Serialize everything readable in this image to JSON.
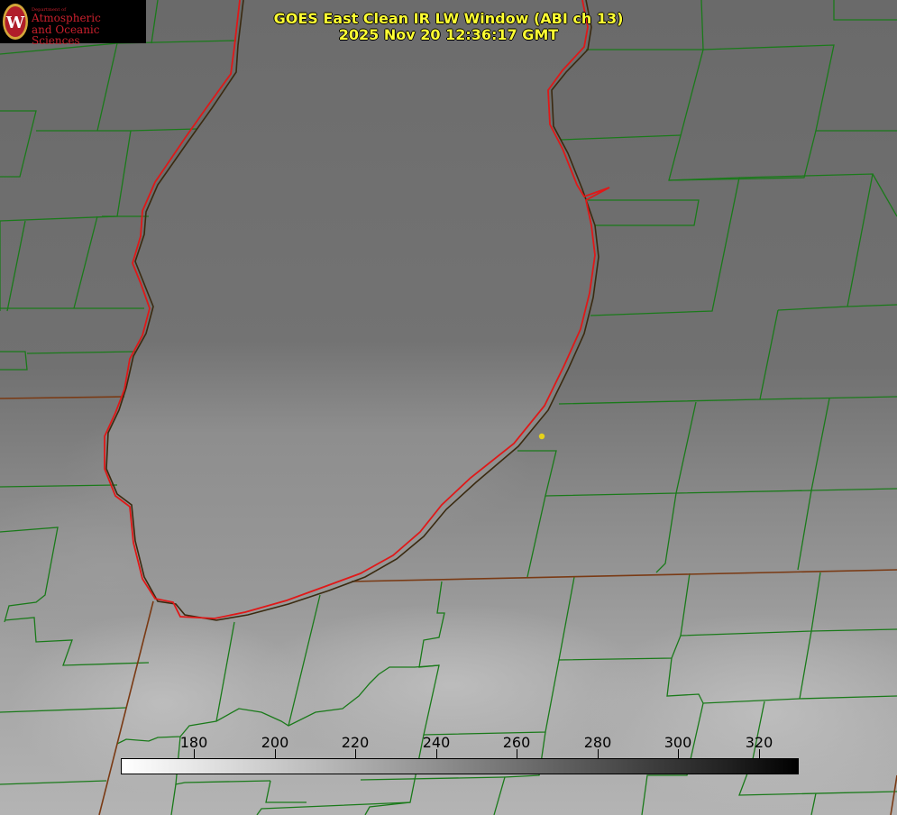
{
  "header": {
    "title_line1": "GOES East Clean IR LW Window (ABI ch 13)",
    "title_line2": "2025 Nov 20 12:36:17 GMT"
  },
  "logo": {
    "department": "Department of",
    "line1": "Atmospheric",
    "line2": "and Oceanic Sciences",
    "seal_letter": "W"
  },
  "colorbar": {
    "tick_labels": [
      "180",
      "200",
      "220",
      "240",
      "260",
      "280",
      "300",
      "320"
    ],
    "tick_values": [
      180,
      200,
      220,
      240,
      260,
      280,
      300,
      320
    ],
    "gradient": "white-to-black"
  },
  "map_colors": {
    "county_lines": "#1a7a1a",
    "state_lines": "#8b3a1a",
    "lake_outline": "#e02020",
    "marker": "#e6d21a",
    "title_text": "#ffff33"
  },
  "icons": {
    "marker": "yellow-dot-icon",
    "seal": "university-seal-icon"
  }
}
